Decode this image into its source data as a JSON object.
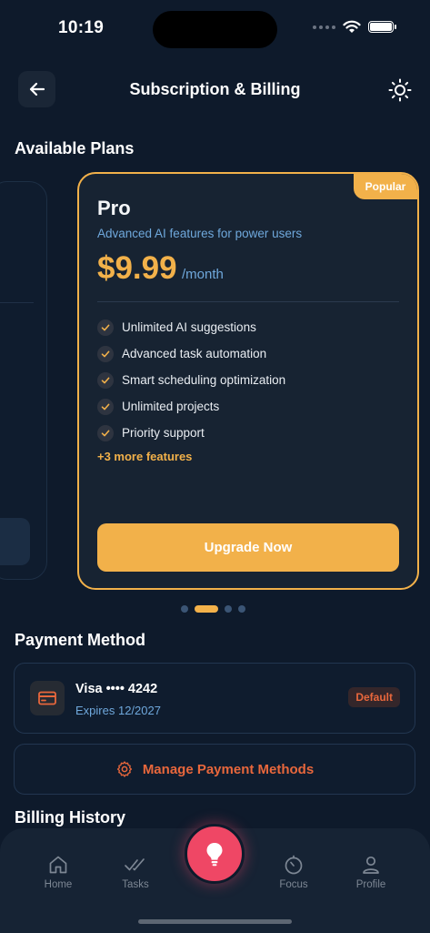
{
  "status": {
    "time": "10:19"
  },
  "header": {
    "title": "Subscription & Billing"
  },
  "plans": {
    "section_title": "Available Plans",
    "pro": {
      "badge": "Popular",
      "name": "Pro",
      "description": "Advanced AI features for power users",
      "price": "$9.99",
      "period": "/month",
      "features": [
        "Unlimited AI suggestions",
        "Advanced task automation",
        "Smart scheduling optimization",
        "Unlimited projects",
        "Priority support"
      ],
      "more_features": "+3 more features",
      "cta": "Upgrade Now"
    },
    "carousel": {
      "count": 4,
      "active_index": 1
    }
  },
  "payment": {
    "section_title": "Payment Method",
    "card_label": "Visa •••• 4242",
    "expires": "Expires 12/2027",
    "default_badge": "Default",
    "manage_label": "Manage Payment Methods"
  },
  "billing": {
    "section_title": "Billing History"
  },
  "tabbar": {
    "items": [
      {
        "label": "Home",
        "icon": "home-icon"
      },
      {
        "label": "Tasks",
        "icon": "tasks-icon"
      },
      {
        "label": "Focus",
        "icon": "focus-icon"
      },
      {
        "label": "Profile",
        "icon": "profile-icon"
      }
    ],
    "fab_icon": "lightbulb-icon"
  },
  "colors": {
    "background": "#0e1a2b",
    "accent": "#f2b14a",
    "danger": "#e8673c",
    "link": "#6fa8dc",
    "fab": "#ef4765"
  }
}
